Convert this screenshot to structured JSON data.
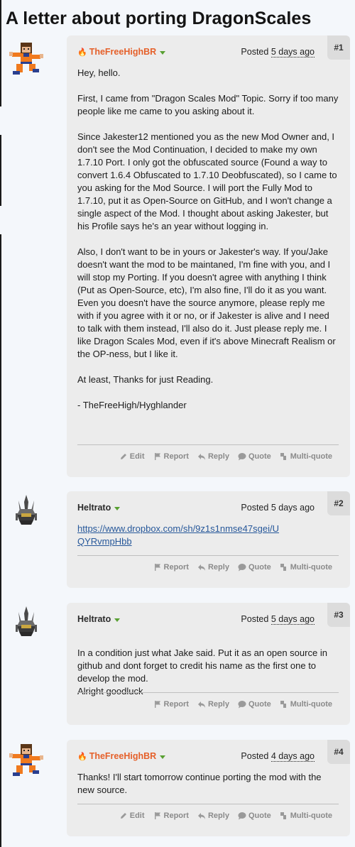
{
  "page": {
    "title": "A letter about porting DragonScales"
  },
  "actions": {
    "edit": "Edit",
    "report": "Report",
    "reply": "Reply",
    "quote": "Quote",
    "multiquote": "Multi-quote"
  },
  "posts": [
    {
      "number": "#1",
      "author": "TheFreeHighBR",
      "posted_label": "Posted",
      "time": "5 days ago",
      "paragraphs": [
        "Hey, hello.",
        "First, I came from \"Dragon Scales Mod\" Topic. Sorry if too many people like me came to you asking about it.",
        "Since Jakester12 mentioned you as the new Mod Owner and, I don't see the Mod Continuation, I decided to make my own 1.7.10 Port. I only got the obfuscated source (Found a way to convert 1.6.4 Obfuscated to 1.7.10 Deobfuscated), so I came to you asking for the Mod Source. I will port the Fully Mod to 1.7.10, put it as Open-Source on GitHub, and I won't change a single aspect of the Mod. I thought about asking Jakester, but his Profile says he's an year without logging in.",
        "Also, I don't want to be in yours or Jakester's way. If you/Jake doesn't want the mod to be maintaned, I'm fine with you, and I will stop my Porting. If you doesn't agree with anything I think (Put as Open-Source, etc), I'm also fine, I'll do it as you want. Even you doesn't have the source anymore, please reply me with if you agree with it or no, or if Jakester is alive and I need to talk with them instead, I'll also do it. Just please reply me. I like Dragon Scales Mod, even if it's above Minecraft Realism or the OP-ness, but I like it.",
        "At least, Thanks for just Reading.",
        "- TheFreeHigh/Hyghlander"
      ]
    },
    {
      "number": "#2",
      "author": "Heltrato",
      "posted_label": "Posted",
      "time": "5 days ago",
      "link": "https://www.dropbox.com/sh/9z1s1nmse47sgei/UQYRvmpHbb"
    },
    {
      "number": "#3",
      "author": "Heltrato",
      "posted_label": "Posted",
      "time": "5 days ago",
      "paragraphs": [
        "In a condition just what Jake said. Put it as an open source in github and dont forget to credit his name as the first one to develop the mod.\nAlright goodluck"
      ]
    },
    {
      "number": "#4",
      "author": "TheFreeHighBR",
      "posted_label": "Posted",
      "time": "4 days ago",
      "paragraphs": [
        "Thanks! I'll start tomorrow continue porting the mod with the new source."
      ]
    }
  ]
}
